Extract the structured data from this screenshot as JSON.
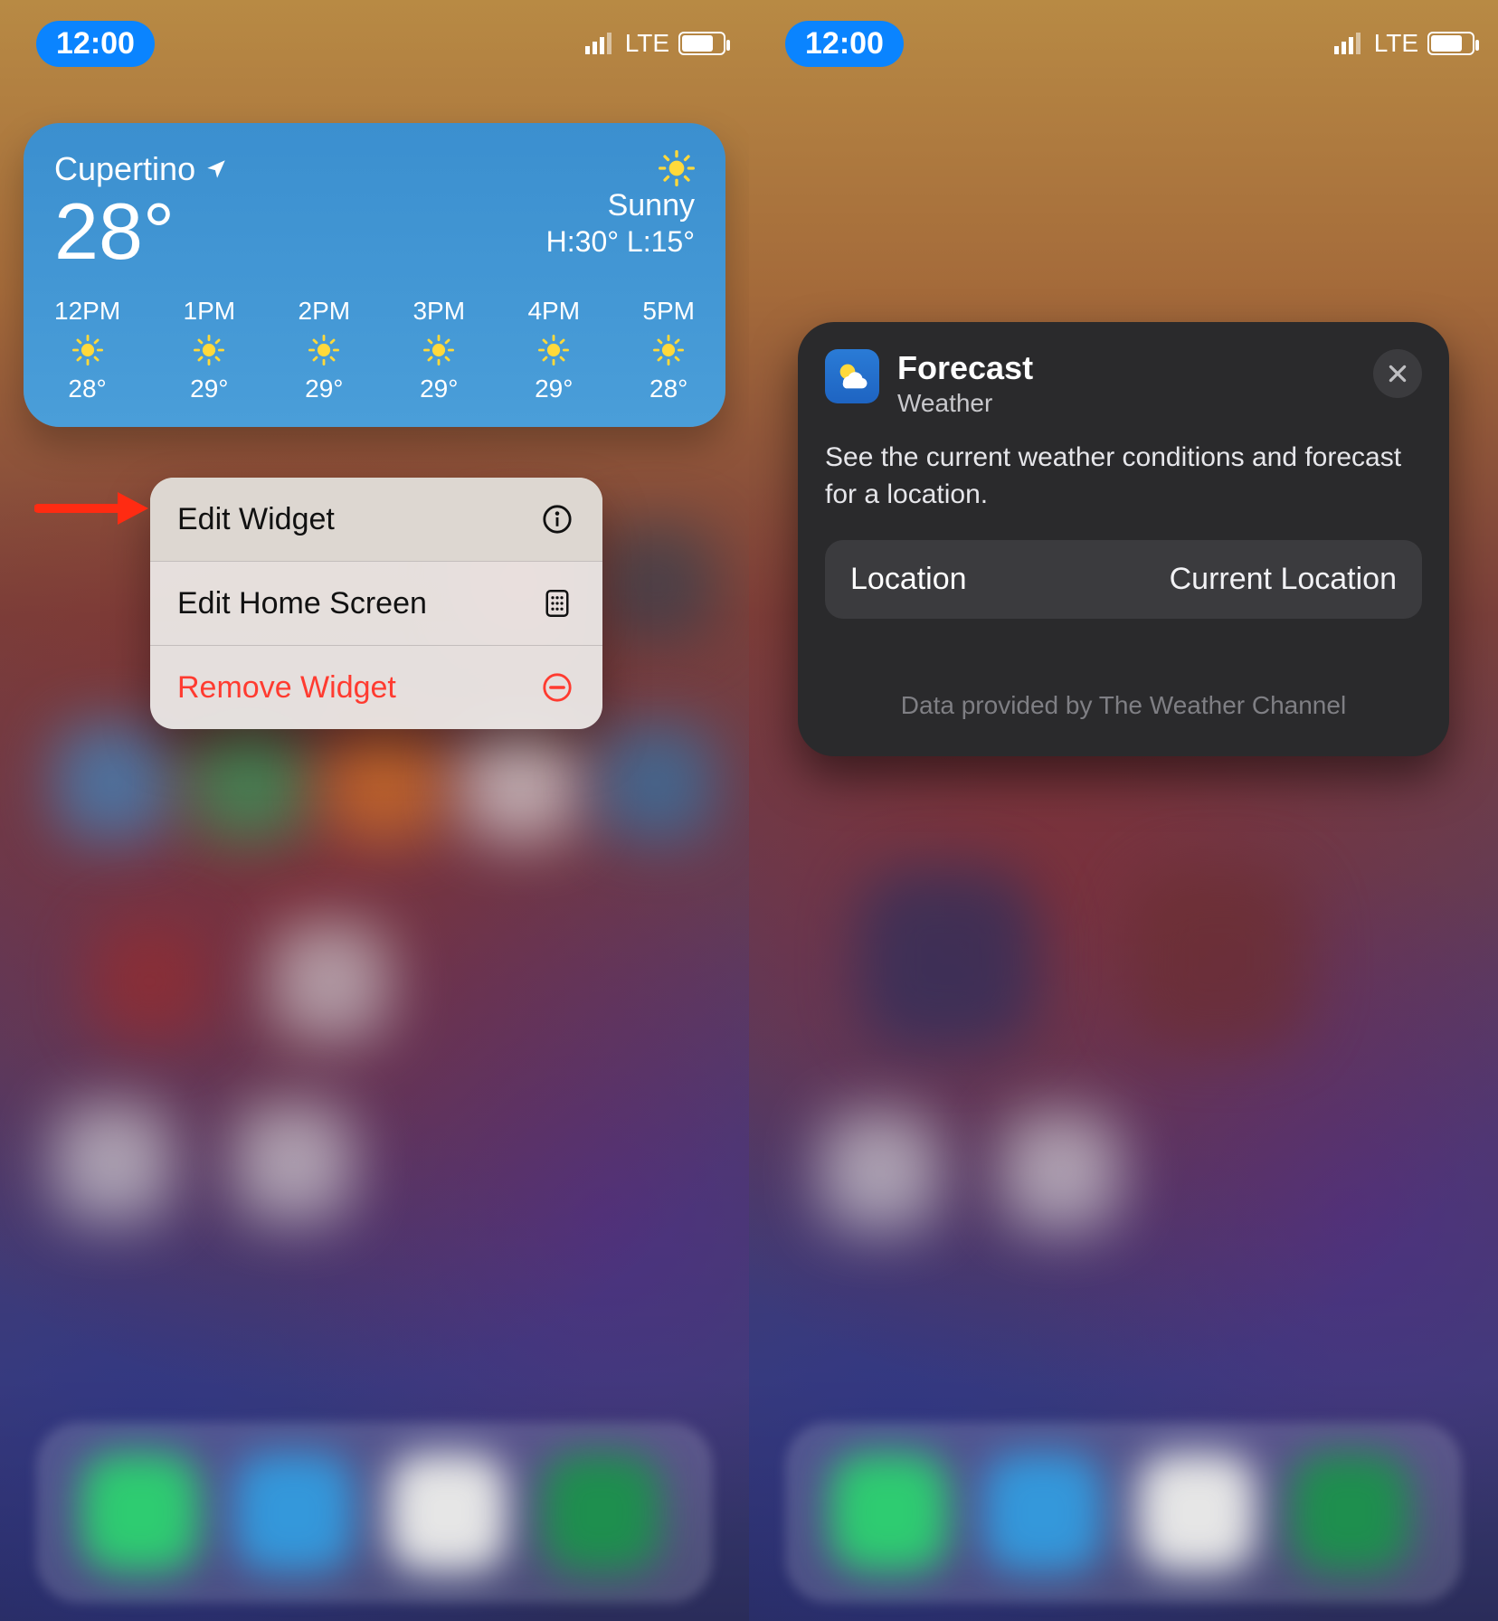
{
  "status": {
    "time": "12:00",
    "network": "LTE"
  },
  "left": {
    "widget": {
      "city": "Cupertino",
      "temp": "28°",
      "condition": "Sunny",
      "hilo": "H:30° L:15°",
      "hours": [
        {
          "label": "12PM",
          "temp": "28°"
        },
        {
          "label": "1PM",
          "temp": "29°"
        },
        {
          "label": "2PM",
          "temp": "29°"
        },
        {
          "label": "3PM",
          "temp": "29°"
        },
        {
          "label": "4PM",
          "temp": "29°"
        },
        {
          "label": "5PM",
          "temp": "28°"
        }
      ]
    },
    "menu": {
      "edit_widget": "Edit Widget",
      "edit_home_screen": "Edit Home Screen",
      "remove_widget": "Remove Widget"
    }
  },
  "right": {
    "sheet": {
      "title": "Forecast",
      "subtitle": "Weather",
      "description": "See the current weather conditions and forecast for a location.",
      "row_label": "Location",
      "row_value": "Current Location",
      "footer": "Data provided by The Weather Channel"
    }
  },
  "colors": {
    "accent_blue": "#0a84ff",
    "destructive": "#ff3b30",
    "widget_top": "#3b8fcf",
    "sheet_bg": "#2a2a2c"
  }
}
